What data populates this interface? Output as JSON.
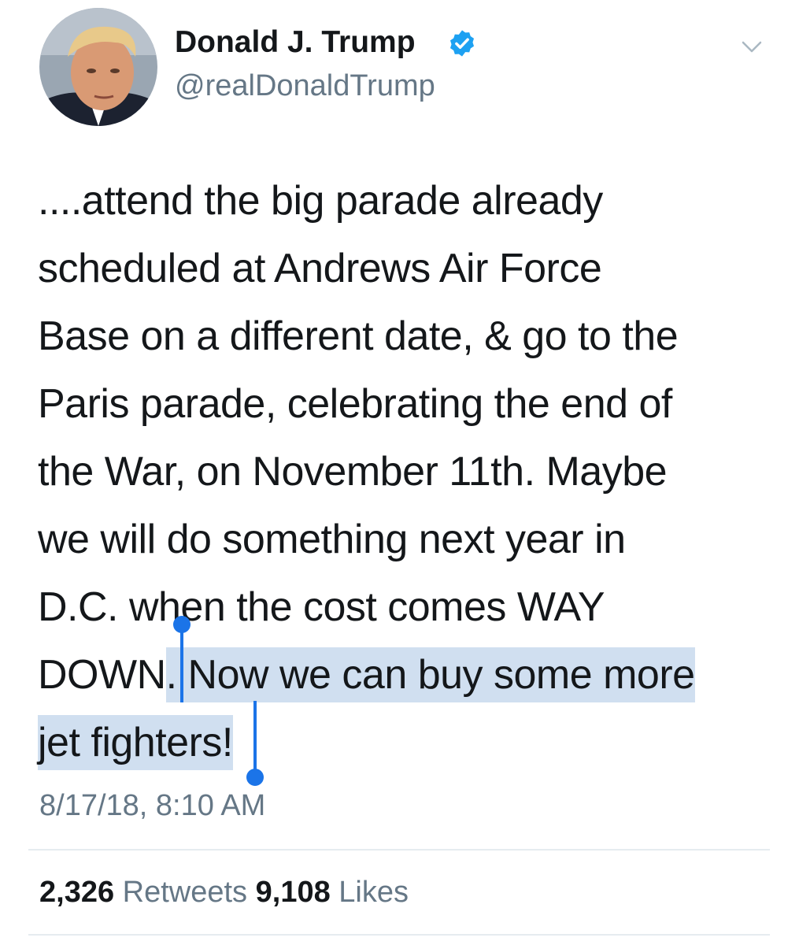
{
  "author": {
    "display_name": "Donald J. Trump",
    "handle": "@realDonaldTrump",
    "verified": true,
    "avatar_icon": "profile-avatar"
  },
  "header": {
    "menu_icon": "chevron-down-icon"
  },
  "tweet": {
    "lines": [
      "....attend the big parade already",
      "scheduled at Andrews Air Force",
      "Base on a different date, & go to the",
      "Paris parade, celebrating the end of",
      "the War, on November 11th. Maybe",
      "we will do something next year in",
      "D.C. when the cost comes WAY"
    ],
    "line8_unselected": "DOWN",
    "line8_selected": ". Now we can buy some more",
    "line9_selected": "jet fighters!",
    "timestamp": "8/17/18, 8:10 AM"
  },
  "stats": {
    "retweets_count": "2,326",
    "retweets_label": "Retweets",
    "likes_count": "9,108",
    "likes_label": "Likes"
  },
  "colors": {
    "selection": "#d0dff0",
    "selection_handle": "#1b74e8",
    "verified": "#1da1f2",
    "secondary_text": "#657786",
    "primary_text": "#14171a"
  }
}
